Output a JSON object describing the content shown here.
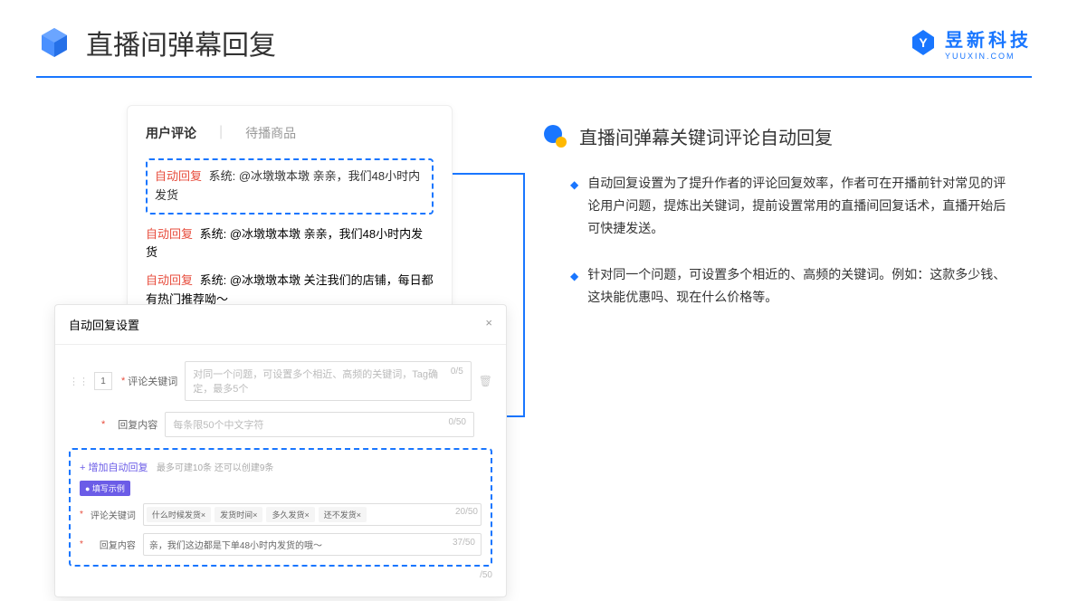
{
  "header": {
    "title": "直播间弹幕回复",
    "brand_name": "昱新科技",
    "brand_sub": "YUUXIN.COM"
  },
  "card1": {
    "tab1": "用户评论",
    "tab2": "待播商品",
    "highlighted_comment": {
      "label": "自动回复",
      "text": "系统: @冰墩墩本墩 亲亲，我们48小时内发货"
    },
    "comments": [
      {
        "label": "自动回复",
        "text": "系统: @冰墩墩本墩 亲亲，我们48小时内发货"
      },
      {
        "label": "自动回复",
        "text": "系统: @冰墩墩本墩 关注我们的店铺，每日都有热门推荐呦～"
      }
    ]
  },
  "card2": {
    "title": "自动回复设置",
    "num": "1",
    "keyword_label": "评论关键词",
    "keyword_placeholder": "对同一个问题，可设置多个相近、高频的关键词，Tag确定，最多5个",
    "keyword_count": "0/5",
    "reply_label": "回复内容",
    "reply_placeholder": "每条限50个中文字符",
    "reply_count": "0/50",
    "add_link": "+ 增加自动回复",
    "add_desc": "最多可建10条 还可以创建9条",
    "badge": "● 填写示例",
    "ex_keyword_label": "评论关键词",
    "ex_tags": [
      "什么时候发货×",
      "发货时间×",
      "多久发货×",
      "还不发货×"
    ],
    "ex_tag_count": "20/50",
    "ex_reply_label": "回复内容",
    "ex_reply_text": "亲，我们这边都是下单48小时内发货的哦～",
    "ex_reply_count": "37/50",
    "outer_count": "/50"
  },
  "right": {
    "subtitle": "直播间弹幕关键词评论自动回复",
    "bullets": [
      "自动回复设置为了提升作者的评论回复效率，作者可在开播前针对常见的评论用户问题，提炼出关键词，提前设置常用的直播间回复话术，直播开始后可快捷发送。",
      "针对同一个问题，可设置多个相近的、高频的关键词。例如：这款多少钱、这块能优惠吗、现在什么价格等。"
    ]
  }
}
